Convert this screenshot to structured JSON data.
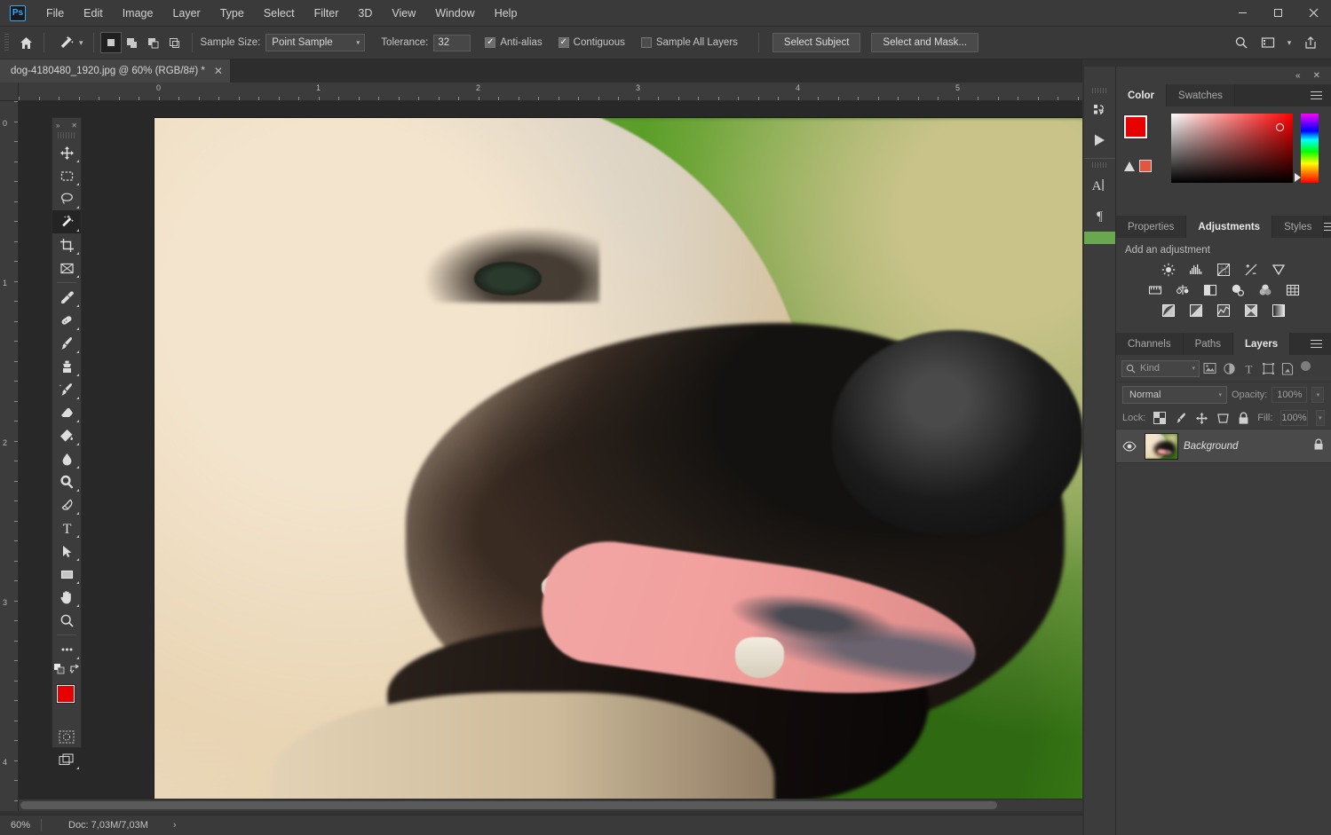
{
  "app": {
    "name": "Adobe Photoshop",
    "logo_text": "Ps"
  },
  "menubar": {
    "items": [
      {
        "label": "File"
      },
      {
        "label": "Edit"
      },
      {
        "label": "Image"
      },
      {
        "label": "Layer"
      },
      {
        "label": "Type"
      },
      {
        "label": "Select"
      },
      {
        "label": "Filter"
      },
      {
        "label": "3D"
      },
      {
        "label": "View"
      },
      {
        "label": "Window"
      },
      {
        "label": "Help"
      }
    ],
    "window_controls": {
      "minimize": "—",
      "maximize": "☐",
      "close": "✕"
    }
  },
  "options_bar": {
    "home_icon": "home-icon",
    "tool_icon": "magic-wand-icon",
    "selection_modes": [
      {
        "name": "new-selection",
        "active": true
      },
      {
        "name": "add-to-selection",
        "active": false
      },
      {
        "name": "subtract-from-selection",
        "active": false
      },
      {
        "name": "intersect-with-selection",
        "active": false
      }
    ],
    "sample_size_label": "Sample Size:",
    "sample_size_value": "Point Sample",
    "tolerance_label": "Tolerance:",
    "tolerance_value": "32",
    "anti_alias_label": "Anti-alias",
    "anti_alias_checked": true,
    "contiguous_label": "Contiguous",
    "contiguous_checked": true,
    "sample_all_layers_label": "Sample All Layers",
    "sample_all_layers_checked": false,
    "select_subject_label": "Select Subject",
    "select_and_mask_label": "Select and Mask...",
    "right_icons": [
      "search-icon",
      "workspace-icon",
      "chevron-down-icon",
      "share-icon"
    ]
  },
  "document_tab": {
    "title": "dog-4180480_1920.jpg @ 60% (RGB/8#) *",
    "close_glyph": "✕"
  },
  "rulers": {
    "unit": "inches",
    "horizontal_labels": [
      "0",
      "1",
      "2",
      "3",
      "4",
      "5"
    ],
    "vertical_labels": [
      "0",
      "1",
      "2",
      "3",
      "4"
    ]
  },
  "status_bar": {
    "zoom": "60%",
    "doc_info": "Doc: 7,03M/7,03M",
    "arrow_glyph": "›"
  },
  "toolbar": {
    "collapse_glyph": "»",
    "close_glyph": "✕",
    "tools": [
      {
        "name": "move-tool",
        "active": false
      },
      {
        "name": "rectangular-marquee-tool",
        "active": false
      },
      {
        "name": "lasso-tool",
        "active": false
      },
      {
        "name": "magic-wand-tool",
        "active": true
      },
      {
        "name": "crop-tool",
        "active": false
      },
      {
        "name": "frame-tool",
        "active": false
      },
      {
        "name": "eyedropper-tool",
        "active": false
      },
      {
        "name": "spot-healing-brush-tool",
        "active": false
      },
      {
        "name": "brush-tool",
        "active": false
      },
      {
        "name": "clone-stamp-tool",
        "active": false
      },
      {
        "name": "history-brush-tool",
        "active": false
      },
      {
        "name": "eraser-tool",
        "active": false
      },
      {
        "name": "gradient-tool",
        "active": false
      },
      {
        "name": "blur-tool",
        "active": false
      },
      {
        "name": "dodge-tool",
        "active": false
      },
      {
        "name": "pen-tool",
        "active": false
      },
      {
        "name": "type-tool",
        "active": false
      },
      {
        "name": "path-selection-tool",
        "active": false
      },
      {
        "name": "rectangle-tool",
        "active": false
      },
      {
        "name": "hand-tool",
        "active": false
      },
      {
        "name": "zoom-tool",
        "active": false
      },
      {
        "name": "edit-toolbar-tool",
        "active": false
      }
    ],
    "foreground_color": "#e60000",
    "background_color": "#e60000",
    "quick_mask_name": "quick-mask-mode",
    "screen_mode_name": "screen-mode"
  },
  "dock_strip": {
    "collapse_glyph": "»",
    "collapse_left_glyph": "«",
    "close_glyph": "✕",
    "icons": [
      {
        "name": "libraries-icon",
        "glyph": "⎙"
      },
      {
        "name": "actions-icon",
        "glyph": "▶"
      },
      {
        "name": "character-icon",
        "glyph": "A"
      },
      {
        "name": "paragraph-icon",
        "glyph": "¶"
      }
    ]
  },
  "color_panel": {
    "tabs": [
      {
        "label": "Color",
        "active": true
      },
      {
        "label": "Swatches",
        "active": false
      }
    ],
    "foreground_color": "#e60000",
    "background_color": "#e60000",
    "out_of_gamut_warning": "gamut-warning-icon",
    "web_safe_color": "#e4553f",
    "menu_icon": "panel-menu-icon"
  },
  "adjustments_panel": {
    "tabs": [
      {
        "label": "Properties",
        "active": false
      },
      {
        "label": "Adjustments",
        "active": true
      },
      {
        "label": "Styles",
        "active": false
      }
    ],
    "heading": "Add an adjustment",
    "rows": [
      [
        {
          "name": "brightness-contrast-icon"
        },
        {
          "name": "levels-icon"
        },
        {
          "name": "curves-icon"
        },
        {
          "name": "exposure-icon"
        },
        {
          "name": "vibrance-icon"
        }
      ],
      [
        {
          "name": "hue-saturation-icon"
        },
        {
          "name": "color-balance-icon"
        },
        {
          "name": "black-white-icon"
        },
        {
          "name": "photo-filter-icon"
        },
        {
          "name": "channel-mixer-icon"
        },
        {
          "name": "color-lookup-icon"
        }
      ],
      [
        {
          "name": "invert-icon"
        },
        {
          "name": "posterize-icon"
        },
        {
          "name": "threshold-icon"
        },
        {
          "name": "selective-color-icon"
        },
        {
          "name": "gradient-map-icon"
        }
      ]
    ],
    "menu_icon": "panel-menu-icon"
  },
  "layers_panel": {
    "tabs": [
      {
        "label": "Channels",
        "active": false
      },
      {
        "label": "Paths",
        "active": false
      },
      {
        "label": "Layers",
        "active": true
      }
    ],
    "menu_icon": "panel-menu-icon",
    "filter": {
      "search_icon": "search-icon",
      "kind_value": "Kind",
      "caret": "▾",
      "type_filters": [
        {
          "name": "filter-pixel-layers-icon"
        },
        {
          "name": "filter-adjustment-layers-icon"
        },
        {
          "name": "filter-type-layers-icon"
        },
        {
          "name": "filter-shape-layers-icon"
        },
        {
          "name": "filter-smart-objects-icon"
        }
      ],
      "toggle_name": "filter-toggle-switch"
    },
    "blend_mode": "Normal",
    "opacity_label": "Opacity:",
    "opacity_value": "100%",
    "lock_label": "Lock:",
    "lock_icons": [
      {
        "name": "lock-transparent-pixels-icon"
      },
      {
        "name": "lock-image-pixels-icon"
      },
      {
        "name": "lock-position-icon"
      },
      {
        "name": "lock-artboard-nesting-icon"
      },
      {
        "name": "lock-all-icon"
      }
    ],
    "fill_label": "Fill:",
    "fill_value": "100%",
    "layers": [
      {
        "name": "Background",
        "visible": true,
        "locked": true,
        "eye_glyph": "◉",
        "lock_glyph": "ὑ2"
      }
    ]
  },
  "canvas": {
    "image_name": "dog-4180480_1920.jpg",
    "description": "close-up photograph of a tan and dark-faced dog with open mouth and tongue out against a green grass background",
    "zoom_percent": "60%"
  },
  "colors": {
    "app_bg": "#323232",
    "panel_bg": "#3c3c3c",
    "menubar_bg": "#3a3a3a",
    "accent_blue": "#31a8ff",
    "foreground": "#e60000",
    "text": "#c9c9c9",
    "grass_green": "#4f9a1d"
  }
}
